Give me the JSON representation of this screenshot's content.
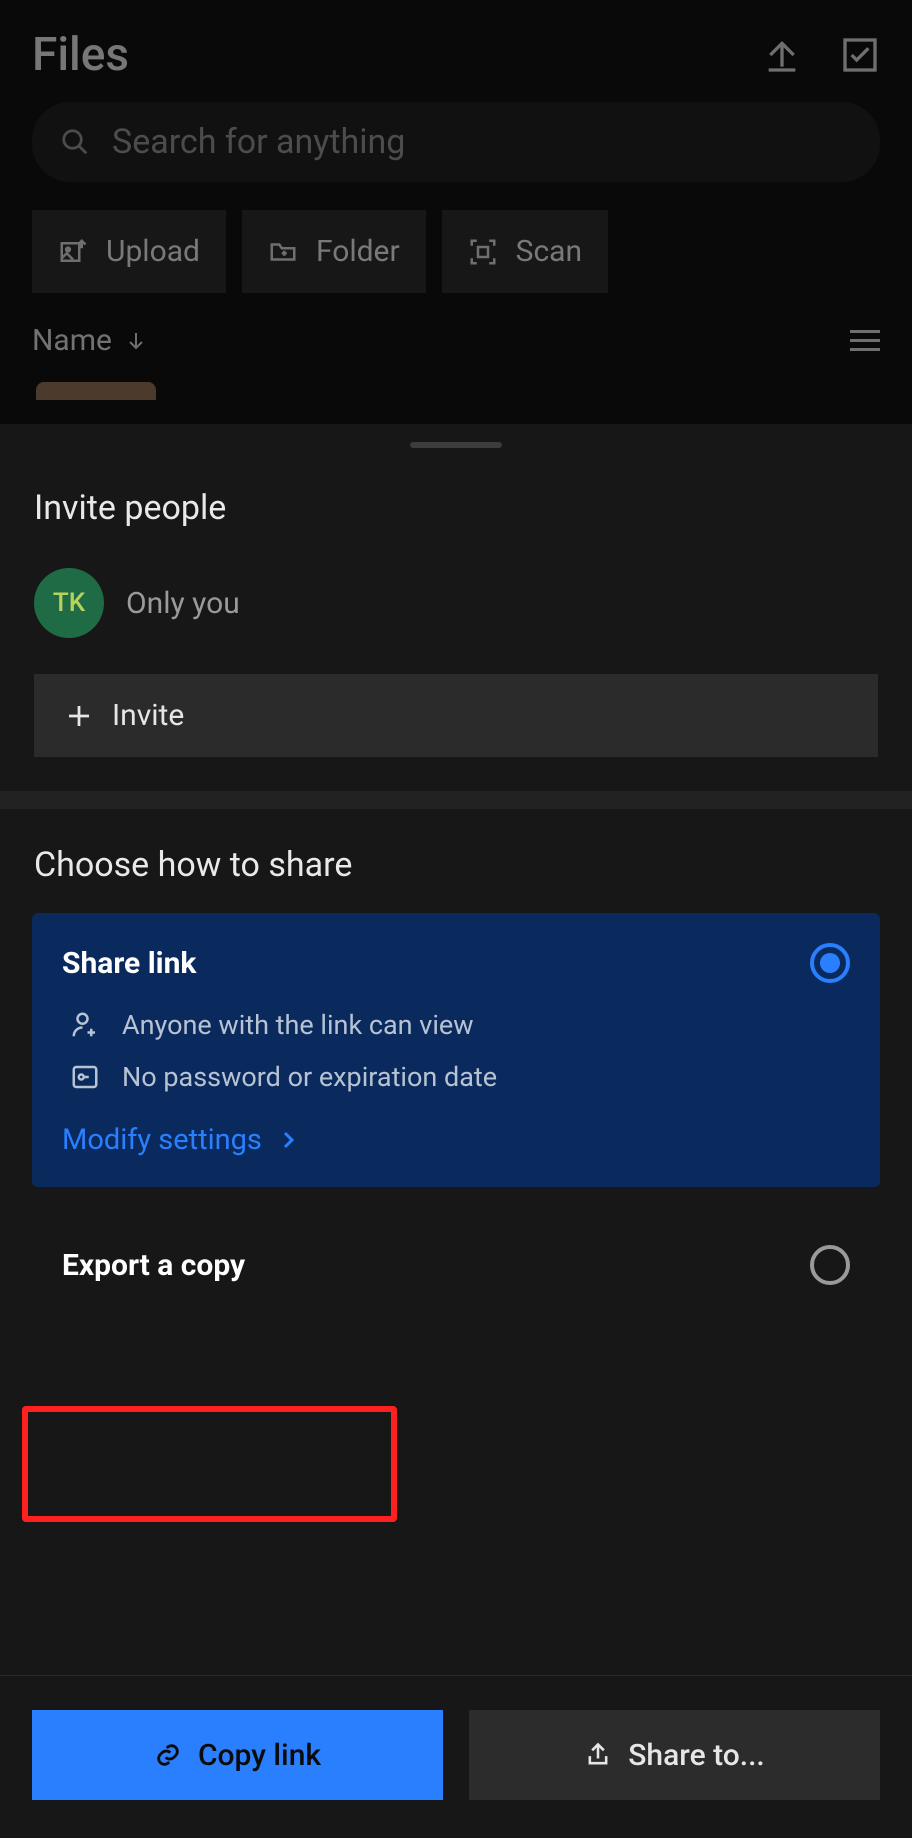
{
  "header": {
    "title": "Files",
    "upload_icon": "upload-arrow",
    "select_icon": "check-box"
  },
  "search": {
    "placeholder": "Search for anything"
  },
  "actions": {
    "upload": "Upload",
    "folder": "Folder",
    "scan": "Scan"
  },
  "column": {
    "label": "Name"
  },
  "sheet": {
    "invite_title": "Invite people",
    "avatar_initials": "TK",
    "only_you": "Only you",
    "invite_button": "Invite",
    "choose_title": "Choose how to share",
    "share_link": {
      "title": "Share link",
      "anyone": "Anyone with the link can view",
      "password": "No password or expiration date",
      "modify": "Modify settings",
      "selected": true
    },
    "export": {
      "title": "Export a copy",
      "selected": false
    },
    "copy_link": "Copy link",
    "share_to": "Share to..."
  },
  "colors": {
    "accent": "#2a7fff",
    "highlight": "#ff2020"
  }
}
